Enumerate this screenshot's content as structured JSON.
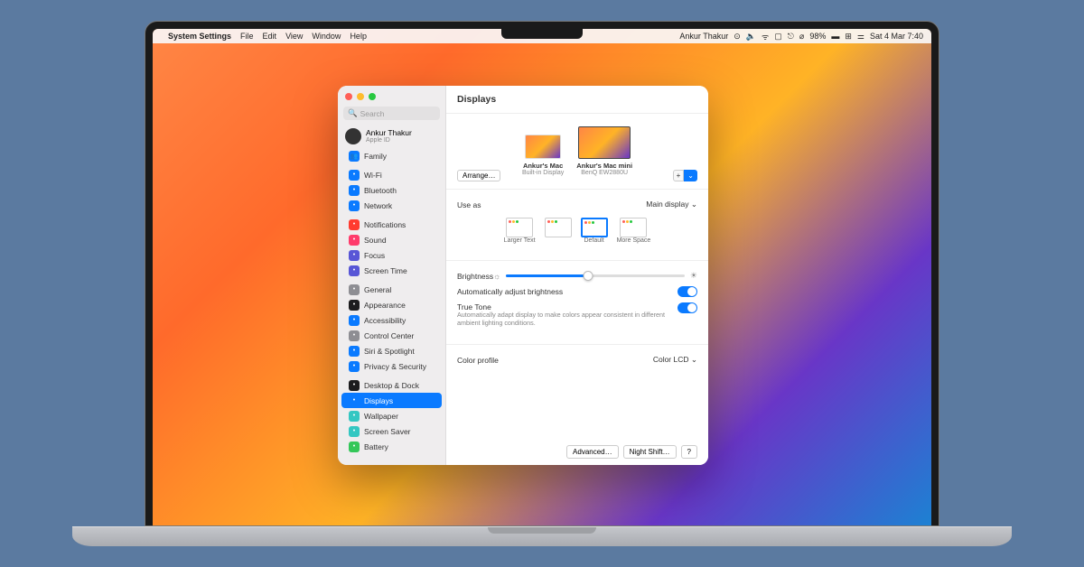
{
  "menubar": {
    "app_name": "System Settings",
    "items": [
      "File",
      "Edit",
      "View",
      "Window",
      "Help"
    ],
    "user": "Ankur Thakur",
    "battery": "98%",
    "datetime": "Sat 4 Mar  7:40"
  },
  "sidebar": {
    "search_placeholder": "Search",
    "profile_name": "Ankur Thakur",
    "profile_sub": "Apple ID",
    "family": "Family",
    "groups": [
      {
        "items": [
          {
            "label": "Wi-Fi",
            "color": "#0a7aff"
          },
          {
            "label": "Bluetooth",
            "color": "#0a7aff"
          },
          {
            "label": "Network",
            "color": "#0a7aff"
          }
        ]
      },
      {
        "items": [
          {
            "label": "Notifications",
            "color": "#ff3b30"
          },
          {
            "label": "Sound",
            "color": "#ff3b6b"
          },
          {
            "label": "Focus",
            "color": "#5856d6"
          },
          {
            "label": "Screen Time",
            "color": "#5856d6"
          }
        ]
      },
      {
        "items": [
          {
            "label": "General",
            "color": "#8e8e93"
          },
          {
            "label": "Appearance",
            "color": "#1c1c1e"
          },
          {
            "label": "Accessibility",
            "color": "#0a7aff"
          },
          {
            "label": "Control Center",
            "color": "#8e8e93"
          },
          {
            "label": "Siri & Spotlight",
            "color": "#0a7aff"
          },
          {
            "label": "Privacy & Security",
            "color": "#0a7aff"
          }
        ]
      },
      {
        "items": [
          {
            "label": "Desktop & Dock",
            "color": "#1c1c1e"
          },
          {
            "label": "Displays",
            "color": "#0a7aff",
            "active": true
          },
          {
            "label": "Wallpaper",
            "color": "#34c7c2"
          },
          {
            "label": "Screen Saver",
            "color": "#34c7c2"
          },
          {
            "label": "Battery",
            "color": "#34c759"
          }
        ]
      }
    ]
  },
  "main": {
    "title": "Displays",
    "arrange": "Arrange…",
    "plus": "+",
    "displays": [
      {
        "name": "Ankur's Mac",
        "sub": "Built-in Display",
        "kind": "mac"
      },
      {
        "name": "Ankur's Mac mini",
        "sub": "BenQ EW2880U",
        "kind": "ext"
      }
    ],
    "use_as_label": "Use as",
    "use_as_value": "Main display",
    "resolutions": [
      "Larger Text",
      "",
      "Default",
      "More Space"
    ],
    "brightness_label": "Brightness",
    "brightness_pct": 46,
    "auto_brightness": "Automatically adjust brightness",
    "truetone_label": "True Tone",
    "truetone_desc": "Automatically adapt display to make colors appear consistent in different ambient lighting conditions.",
    "color_profile_label": "Color profile",
    "color_profile_value": "Color LCD",
    "advanced": "Advanced…",
    "night_shift": "Night Shift…",
    "help": "?"
  }
}
